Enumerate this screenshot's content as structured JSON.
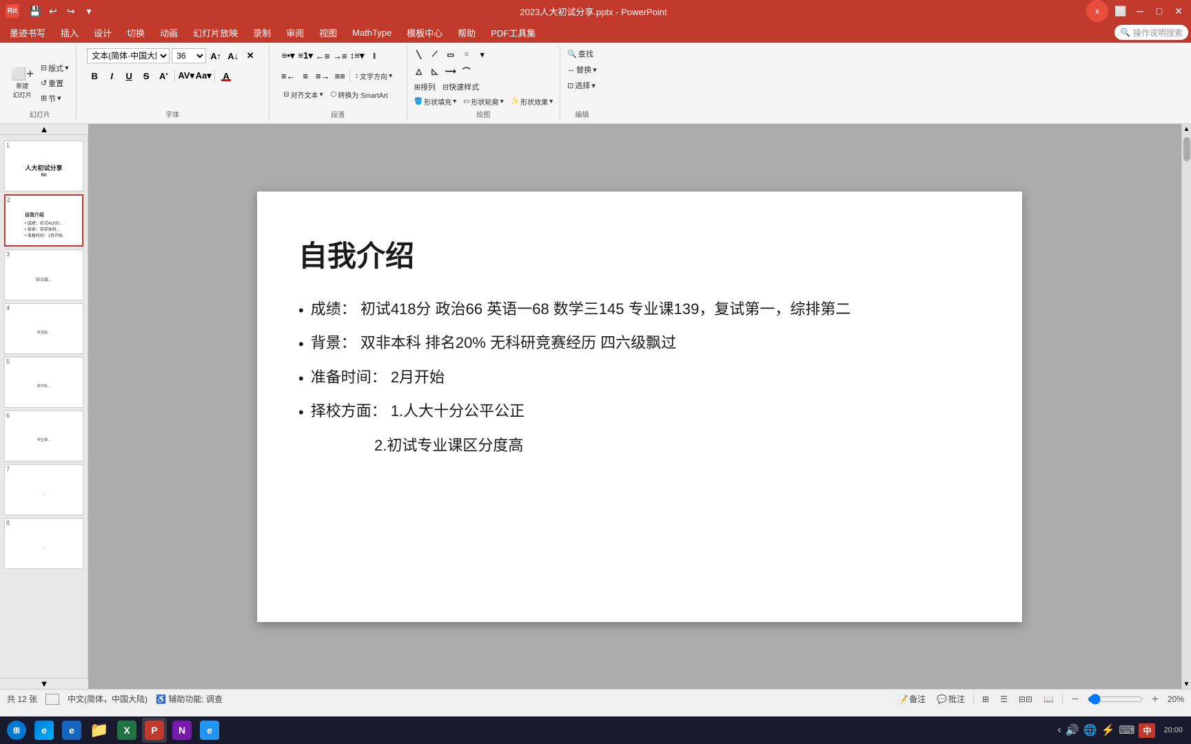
{
  "titlebar": {
    "title": "2023人大初试分享.pptx - PowerPoint",
    "app_name": "PowerPoint",
    "quick_save": "💾",
    "quick_undo": "↩",
    "quick_redo": "↪",
    "min_btn": "─",
    "max_btn": "□",
    "close_btn": "✕"
  },
  "menubar": {
    "items": [
      {
        "label": "墨迹书写",
        "id": "ink"
      },
      {
        "label": "插入",
        "id": "insert"
      },
      {
        "label": "设计",
        "id": "design"
      },
      {
        "label": "切换",
        "id": "transition"
      },
      {
        "label": "动画",
        "id": "animation"
      },
      {
        "label": "幻灯片放映",
        "id": "slideshow"
      },
      {
        "label": "录制",
        "id": "record"
      },
      {
        "label": "审阅",
        "id": "review"
      },
      {
        "label": "视图",
        "id": "view"
      },
      {
        "label": "MathType",
        "id": "mathtype"
      },
      {
        "label": "模板中心",
        "id": "template"
      },
      {
        "label": "帮助",
        "id": "help"
      },
      {
        "label": "PDF工具集",
        "id": "pdf"
      },
      {
        "label": "🔍",
        "id": "search_icon"
      },
      {
        "label": "操作说明搜索",
        "id": "search"
      }
    ]
  },
  "ribbon": {
    "slides_group": {
      "label": "幻灯片",
      "new_slide": "新建\n幻灯片",
      "layout": "版式",
      "reset": "重置",
      "section": "节"
    },
    "font_group": {
      "label": "字体",
      "font_name": "文本(简体·中国大陆)",
      "font_size": "36",
      "increase": "A↑",
      "decrease": "A↓",
      "clear": "A⃝",
      "bold": "B",
      "italic": "I",
      "underline": "U",
      "strikethrough": "S",
      "shadow": "A'",
      "char_spacing": "AV",
      "change_case": "Aa",
      "font_color": "A"
    },
    "paragraph_group": {
      "label": "段落",
      "bullets": "≡•",
      "numbering": "≡1",
      "decrease_indent": "←≡",
      "increase_indent": "→≡",
      "line_spacing": "↕≡",
      "align_left": "≡←",
      "center": "≡",
      "align_right": "≡→",
      "justify": "≡≡",
      "columns": "⫿",
      "text_direction": "文字方向",
      "align_text": "对齐文本",
      "smartart": "转换为 SmartArt"
    },
    "drawing_group": {
      "label": "绘图",
      "shape_fill": "形状填充",
      "shape_outline": "形状轮廓",
      "shape_effect": "形状效果",
      "arrange": "排列",
      "quick_styles": "快速样式"
    },
    "editing_group": {
      "label": "编辑",
      "find": "查找",
      "replace": "替换",
      "select": "选择"
    }
  },
  "slides": [
    {
      "id": 1,
      "active": false,
      "title": "人大初试分享",
      "preview_text": "人大初试分享"
    },
    {
      "id": 2,
      "active": true,
      "title": "自我介绍",
      "preview_text": "自我介绍"
    },
    {
      "id": 3,
      "active": false,
      "preview_text": "..."
    },
    {
      "id": 4,
      "active": false,
      "preview_text": "..."
    },
    {
      "id": 5,
      "active": false,
      "preview_text": "..."
    },
    {
      "id": 6,
      "active": false,
      "preview_text": "..."
    },
    {
      "id": 7,
      "active": false,
      "preview_text": "..."
    },
    {
      "id": 8,
      "active": false,
      "preview_text": "..."
    }
  ],
  "current_slide": {
    "title": "自我介绍",
    "bullets": [
      {
        "text": "成绩： 初试418分 政治66 英语一68 数学三145 专业课139，复试第一，综排第二"
      },
      {
        "text": "背景： 双非本科 排名20% 无科研竞赛经历 四六级飘过"
      },
      {
        "text": "准备时间： 2月开始"
      },
      {
        "text": "择校方面： 1.人大十分公平公正"
      },
      {
        "text": "2.初试专业课区分度高",
        "indent": true
      }
    ]
  },
  "statusbar": {
    "slide_count": "共 12 张",
    "current": "2",
    "language": "中文(简体，中国大陆)",
    "accessibility": "辅助功能: 调查",
    "notes": "备注",
    "comments": "批注",
    "view_normal": "普通",
    "view_outline": "大纲",
    "view_slide_sorter": "幻灯片浏览",
    "view_reading": "阅读视图",
    "zoom_out": "－",
    "zoom_level": "20%",
    "zoom_in": "＋"
  },
  "taskbar": {
    "apps": [
      {
        "name": "start",
        "color": "#0078d4",
        "label": "⊞"
      },
      {
        "name": "edge",
        "color": "#0066cc",
        "label": "e"
      },
      {
        "name": "ie",
        "color": "#1a6bcc",
        "label": "e"
      },
      {
        "name": "folder",
        "color": "#f0a030",
        "label": "📁"
      },
      {
        "name": "excel",
        "color": "#217346",
        "label": "X"
      },
      {
        "name": "powerpoint",
        "color": "#c0392b",
        "label": "P"
      },
      {
        "name": "onenote",
        "color": "#7719AA",
        "label": "N"
      },
      {
        "name": "edge2",
        "color": "#0066cc",
        "label": "e"
      }
    ],
    "tray": {
      "time": "20",
      "lang": "中",
      "network": "🌐"
    }
  }
}
